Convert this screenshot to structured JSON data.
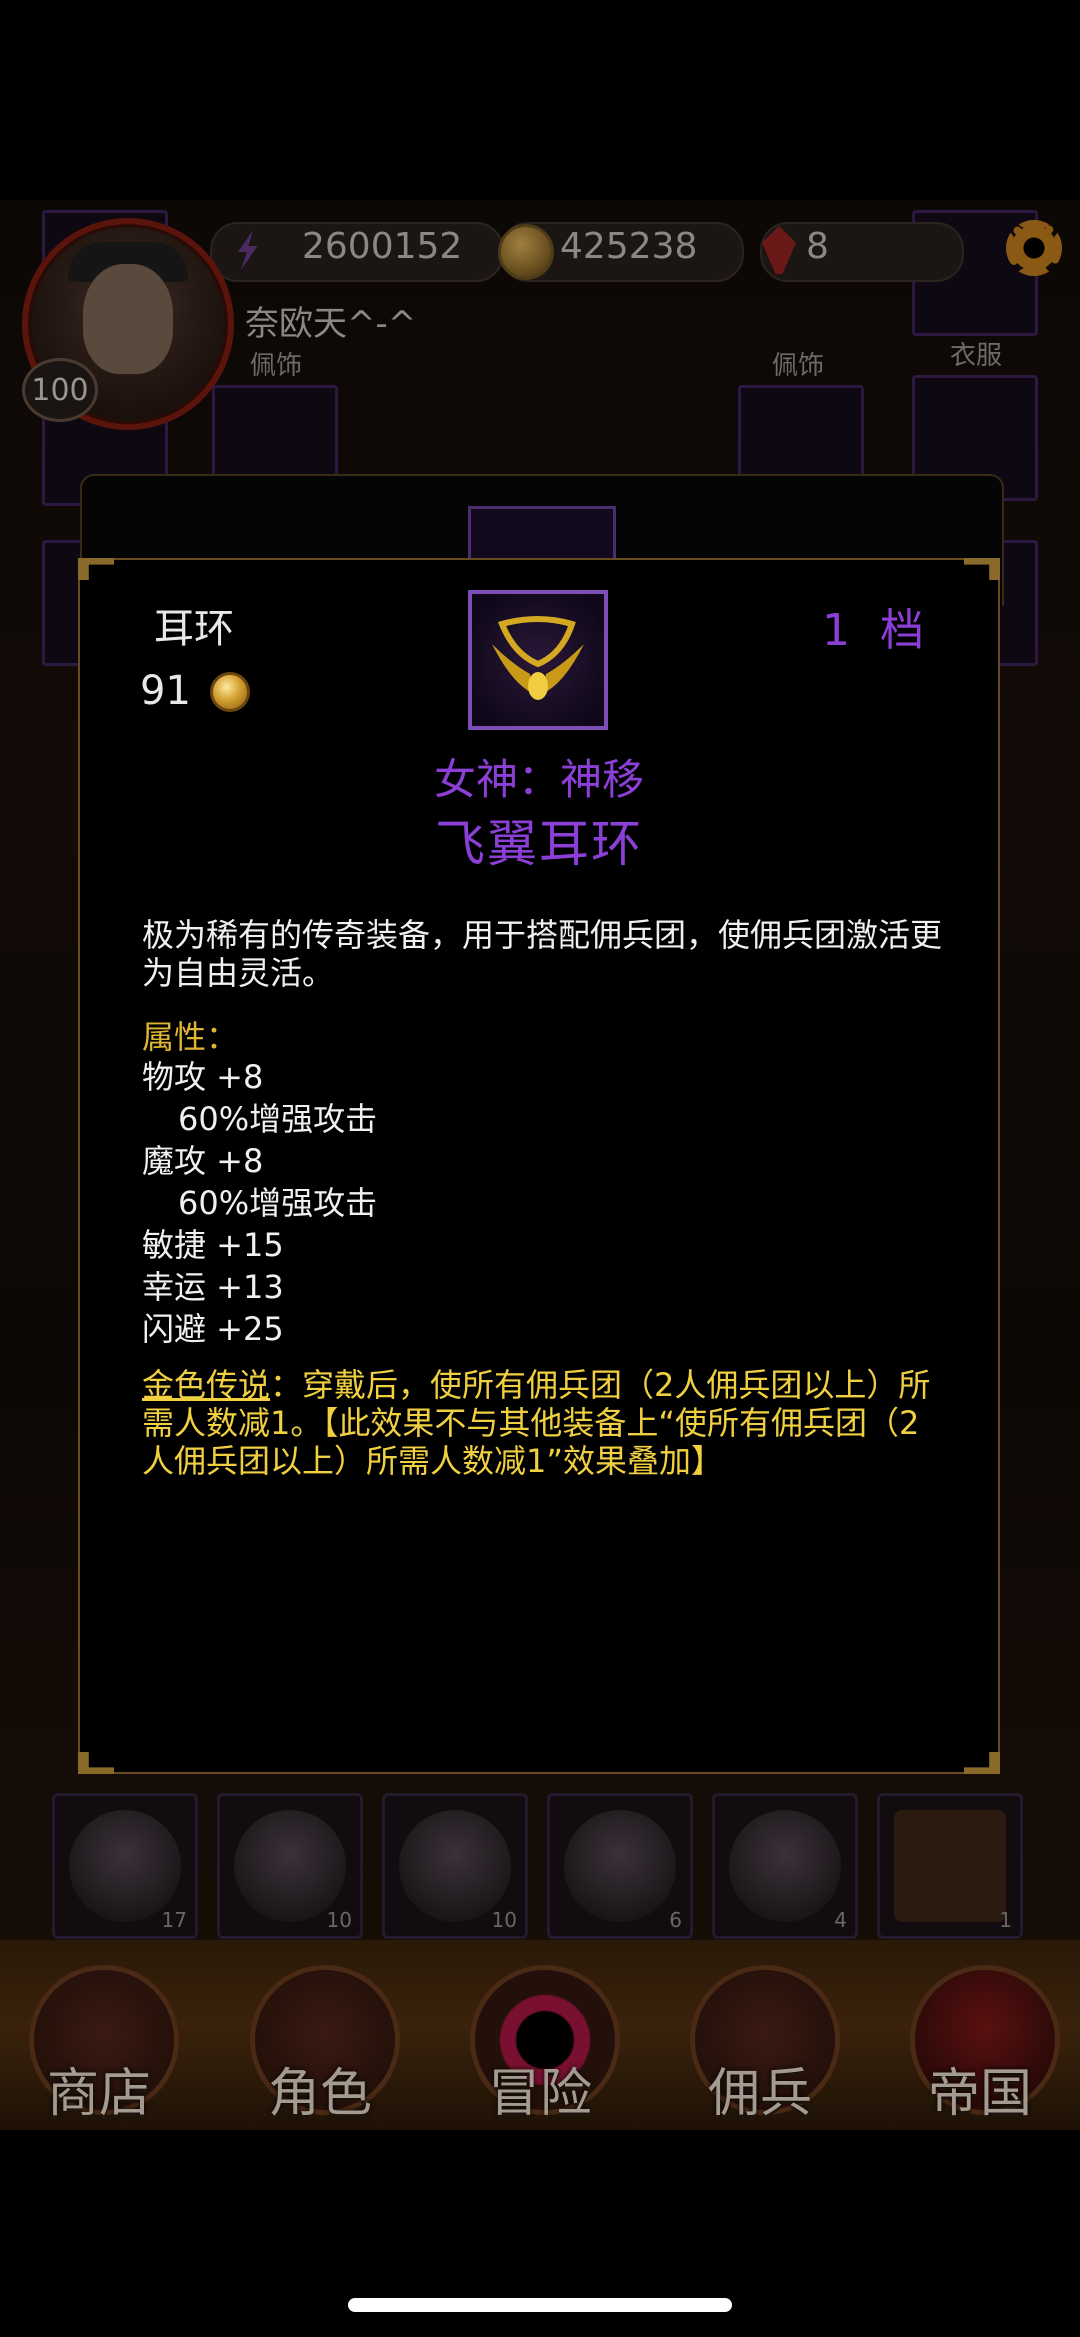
{
  "hud": {
    "player_level": "100",
    "player_name": "奈欧天^-^",
    "energy": "2600152",
    "gold": "425238",
    "gems": "8"
  },
  "equip_slots": {
    "accessory_left": "佩饰",
    "accessory_right": "佩饰",
    "clothes": "衣服"
  },
  "item_popup": {
    "slot_type": "耳环",
    "price": "91",
    "tier": "1 档",
    "set_name": "女神：神移",
    "item_name": "飞翼耳环",
    "description": "极为稀有的传奇装备，用于搭配佣兵团，使佣兵团激活更为自由灵活。",
    "attributes_title": "属性：",
    "attributes": [
      {
        "text": "物攻 +8",
        "sub": false
      },
      {
        "text": "60%增强攻击",
        "sub": true
      },
      {
        "text": "魔攻 +8",
        "sub": false
      },
      {
        "text": "60%增强攻击",
        "sub": true
      },
      {
        "text": "敏捷 +15",
        "sub": false
      },
      {
        "text": "幸运 +13",
        "sub": false
      },
      {
        "text": "闪避 +25",
        "sub": false
      }
    ],
    "legend_label": "金色传说",
    "legend_text": "：穿戴后，使所有佣兵团（2人佣兵团以上）所需人数减1。【此效果不与其他装备上“使所有佣兵团（2人佣兵团以上）所需人数减1”效果叠加】"
  },
  "hero_row": [
    {
      "count": "17"
    },
    {
      "count": "10"
    },
    {
      "count": "10"
    },
    {
      "count": "6"
    },
    {
      "count": "4"
    },
    {
      "count": "1"
    }
  ],
  "nav": [
    {
      "label": "商店"
    },
    {
      "label": "角色"
    },
    {
      "label": "冒险"
    },
    {
      "label": "佣兵"
    },
    {
      "label": "帝国"
    }
  ],
  "colors": {
    "legendary_purple": "#8b3fd6",
    "attribute_gold": "#e0b630",
    "legend_yellow": "#f0d040"
  }
}
